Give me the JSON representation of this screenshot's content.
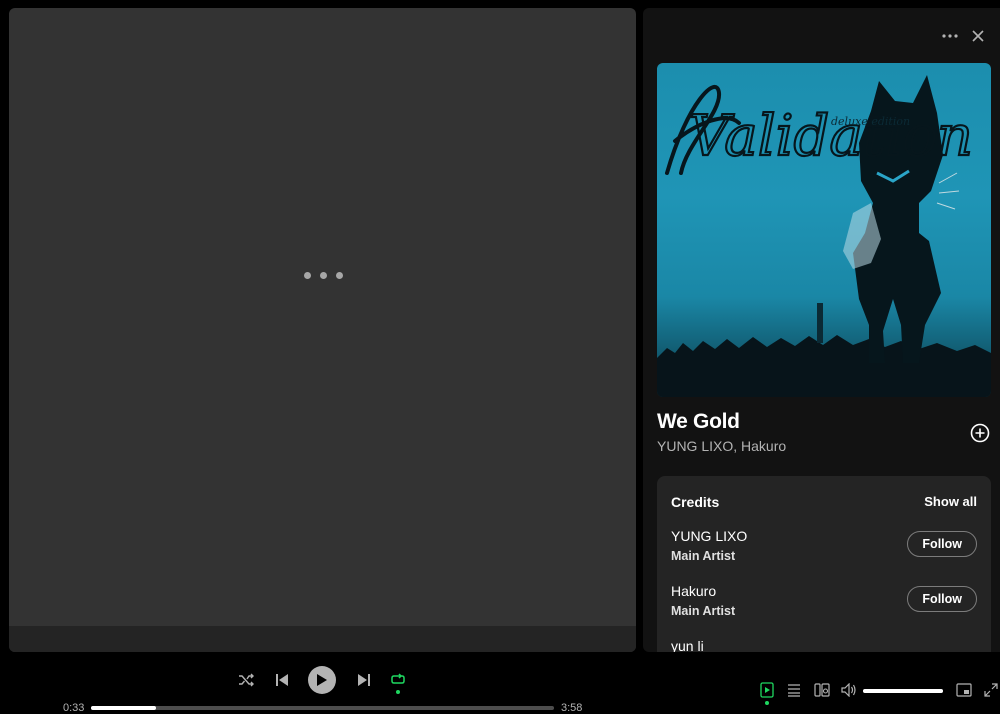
{
  "main": {
    "loading_icon": "more-dots-icon"
  },
  "now_playing": {
    "more_icon": "more-horizontal-icon",
    "close_icon": "close-icon",
    "cover": {
      "title_art": "Validation",
      "edition_art": "deluxe edition"
    },
    "track_title": "We Gold",
    "track_artists": "YUNG LIXO, Hakuro",
    "add_icon": "add-circle-icon"
  },
  "credits": {
    "title": "Credits",
    "show_all": "Show all",
    "rows": [
      {
        "name": "YUNG LIXO",
        "role": "Main Artist",
        "follow": "Follow"
      },
      {
        "name": "Hakuro",
        "role": "Main Artist",
        "follow": "Follow"
      },
      {
        "name": "yun li"
      }
    ]
  },
  "player": {
    "elapsed": "0:33",
    "duration": "3:58",
    "progress": 0.14,
    "volume": 1.0,
    "shuffle_icon": "shuffle-icon",
    "previous_icon": "skip-back-icon",
    "play_icon": "play-icon",
    "next_icon": "skip-forward-icon",
    "repeat_icon": "repeat-icon",
    "now_playing_view_icon": "now-playing-view-icon",
    "queue_icon": "queue-icon",
    "connect_icon": "connect-device-icon",
    "volume_icon": "volume-icon",
    "miniplayer_icon": "miniplayer-icon",
    "fullscreen_icon": "fullscreen-icon",
    "accent_color": "#1ed760"
  }
}
